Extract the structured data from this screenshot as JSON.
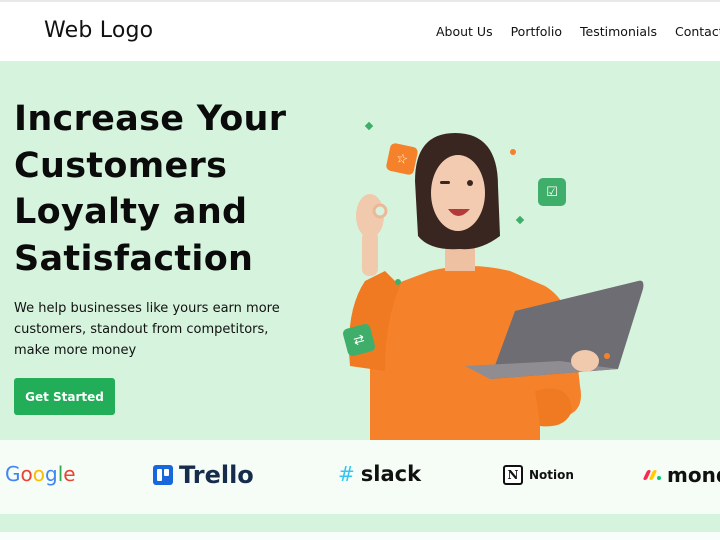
{
  "header": {
    "logo": "Web Logo",
    "nav": [
      "About Us",
      "Portfolio",
      "Testimonials",
      "Contact"
    ]
  },
  "hero": {
    "headline_lines": [
      "Increase Your",
      "Customers",
      "Loyalty and",
      "Satisfaction"
    ],
    "subtext_lines": [
      "We help businesses like yours earn more",
      "customers, standout from competitors,",
      "make more money"
    ],
    "cta_label": "Get Started",
    "image_alt": "Smiling woman in orange sweater holding a laptop and making an OK gesture"
  },
  "logos": {
    "items": [
      {
        "name": "Google",
        "icon": "google-wordmark"
      },
      {
        "name": "Trello",
        "icon": "trello-board-icon"
      },
      {
        "name": "slack",
        "icon": "slack-hash-icon"
      },
      {
        "name": "Notion",
        "icon": "notion-n-icon"
      },
      {
        "name": "monday",
        "icon": "monday-dots-icon"
      }
    ]
  },
  "colors": {
    "accent": "#22ad59",
    "hero_bg": "#d6f4dd",
    "orange": "#f5822a",
    "badge_green": "#3fae6a",
    "trello_blue": "#1868db",
    "trello_text": "#172b4d"
  }
}
